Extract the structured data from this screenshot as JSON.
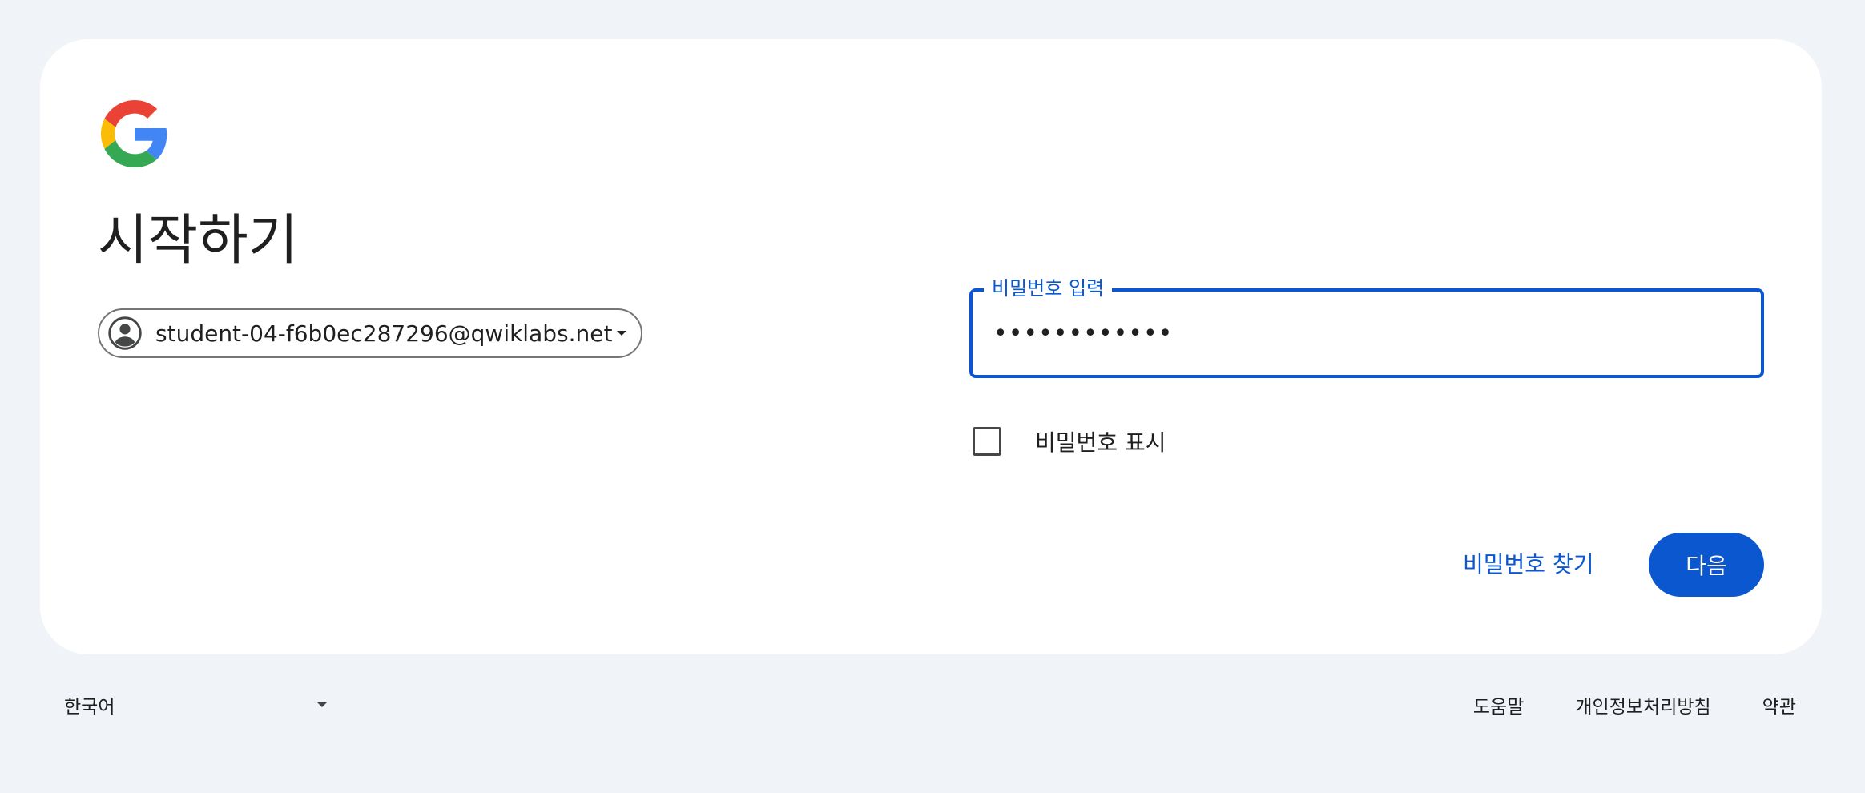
{
  "brand": {
    "logo_icon": "google-g-logo",
    "colors": {
      "red": "#EA4335",
      "yellow": "#FBBC05",
      "green": "#34A853",
      "blue": "#4285F4"
    }
  },
  "page": {
    "title": "시작하기"
  },
  "account": {
    "email": "student-04-f6b0ec287296@qwiklabs.net",
    "avatar_icon": "account-circle-icon",
    "dropdown_icon": "chevron-down-icon"
  },
  "password": {
    "label": "비밀번호 입력",
    "value": "••••••••••••",
    "show_password_label": "비밀번호 표시",
    "show_password_checked": false
  },
  "actions": {
    "forgot_password": "비밀번호 찾기",
    "next": "다음"
  },
  "footer": {
    "language": "한국어",
    "links": {
      "help": "도움말",
      "privacy": "개인정보처리방침",
      "terms": "약관"
    }
  },
  "colors": {
    "accent": "#0b57d0",
    "background": "#f0f4f9",
    "card": "#ffffff"
  }
}
